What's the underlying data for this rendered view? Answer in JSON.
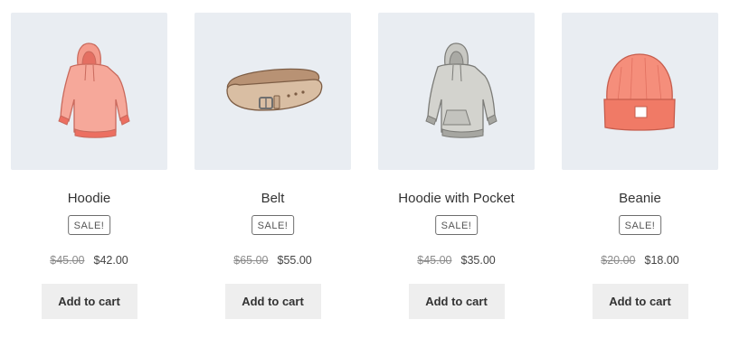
{
  "products": [
    {
      "title": "Hoodie",
      "badge": "SALE!",
      "regular_price": "$45.00",
      "sale_price": "$42.00",
      "button_label": "Add to cart",
      "image_icon": "pink-hoodie-icon",
      "image_color": "#f0857a"
    },
    {
      "title": "Belt",
      "badge": "SALE!",
      "regular_price": "$65.00",
      "sale_price": "$55.00",
      "button_label": "Add to cart",
      "image_icon": "leather-belt-icon",
      "image_color": "#c9a98a"
    },
    {
      "title": "Hoodie with Pocket",
      "badge": "SALE!",
      "regular_price": "$45.00",
      "sale_price": "$35.00",
      "button_label": "Add to cart",
      "image_icon": "gray-hoodie-pocket-icon",
      "image_color": "#bdbdb8"
    },
    {
      "title": "Beanie",
      "badge": "SALE!",
      "regular_price": "$20.00",
      "sale_price": "$18.00",
      "button_label": "Add to cart",
      "image_icon": "orange-beanie-icon",
      "image_color": "#f07f6a"
    }
  ],
  "colors": {
    "thumb_background": "#e9edf2",
    "button_background": "#eeeeee",
    "text": "#333333",
    "strikethrough_price": "#8c8c8c"
  }
}
